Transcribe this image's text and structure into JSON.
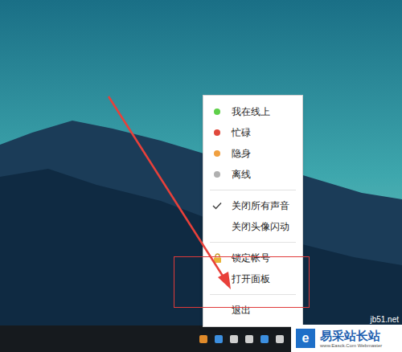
{
  "menu": {
    "groups": [
      [
        {
          "label": "我在线上",
          "kind": "status",
          "color": "#5fd04a"
        },
        {
          "label": "忙碌",
          "kind": "status",
          "color": "#e0493c"
        },
        {
          "label": "隐身",
          "kind": "status",
          "color": "#f0a040"
        },
        {
          "label": "离线",
          "kind": "status",
          "color": "#b0b0b0"
        }
      ],
      [
        {
          "label": "关闭所有声音",
          "kind": "check",
          "checked": true
        },
        {
          "label": "关闭头像闪动",
          "kind": "check",
          "checked": false
        }
      ],
      [
        {
          "label": "锁定帐号",
          "kind": "lock"
        },
        {
          "label": "打开面板",
          "kind": "plain"
        }
      ],
      [
        {
          "label": "退出",
          "kind": "plain"
        }
      ]
    ]
  },
  "watermark": {
    "logo": "e",
    "title": "易采站长站",
    "subtitle": "www.Easck.Com Webmaster",
    "behind": "jb51.net"
  }
}
